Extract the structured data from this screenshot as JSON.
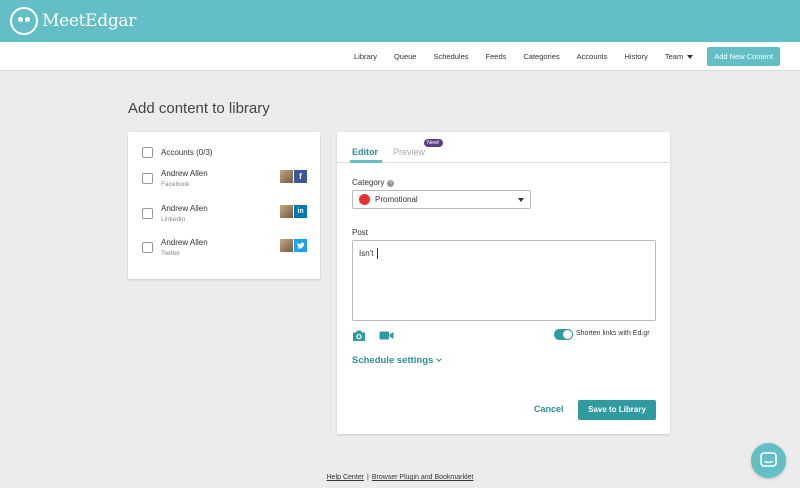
{
  "app": {
    "logo_text": "MeetEdgar"
  },
  "nav": {
    "links": [
      "Library",
      "Queue",
      "Schedules",
      "Feeds",
      "Categories",
      "Accounts",
      "History",
      "Team"
    ],
    "add_button": "Add New Content"
  },
  "page": {
    "title": "Add content to library"
  },
  "accounts": {
    "header": "Accounts (0/3)",
    "items": [
      {
        "name": "Andrew Allen",
        "network": "Facebook",
        "badge": "f",
        "badge_icon": "facebook-icon",
        "color": "#3b5998"
      },
      {
        "name": "Andrew Allen",
        "network": "Linkedin",
        "badge": "in",
        "badge_icon": "linkedin-icon",
        "color": "#0077b5"
      },
      {
        "name": "Andrew Allen",
        "network": "Twitter",
        "badge": "t",
        "badge_icon": "twitter-icon",
        "color": "#1da1f2"
      }
    ]
  },
  "editor": {
    "tabs": {
      "editor": "Editor",
      "preview": "Preview",
      "new_badge": "New!"
    },
    "category_label": "Category",
    "category_value": "Promotional",
    "category_color": "#e53131",
    "post_label": "Post",
    "post_value": "Isn't",
    "shorten_label": "Shorten links with Ed.gr",
    "shorten_enabled": true,
    "schedule_settings": "Schedule settings",
    "cancel": "Cancel",
    "save": "Save to Library"
  },
  "footer": {
    "help_center": "Help Center",
    "separator": "|",
    "plugin": "Browser Plugin and Bookmarklet"
  },
  "colors": {
    "brand": "#63bfc5",
    "accent": "#2f9aa0",
    "badge_purple": "#5b3f7e"
  }
}
